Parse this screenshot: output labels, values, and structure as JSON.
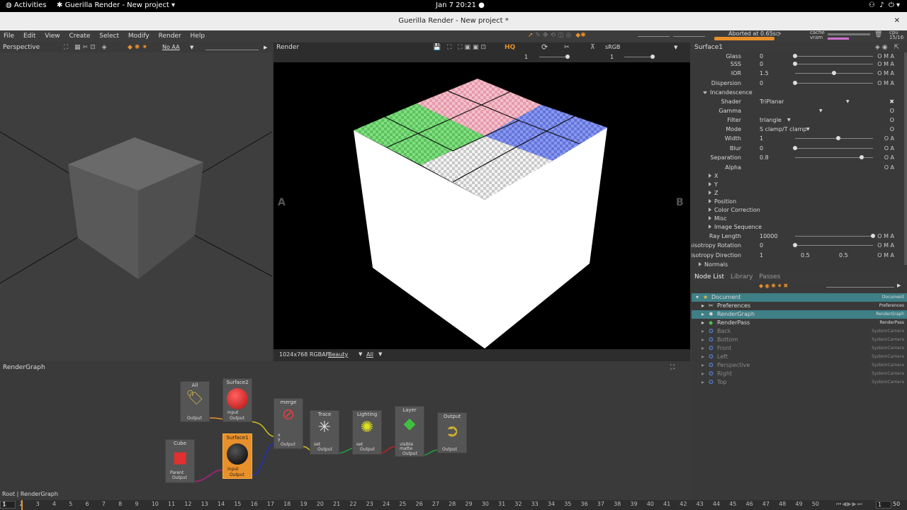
{
  "topbar": {
    "activities": "Activities",
    "app": "Guerilla Render - New project",
    "clock": "Jan 7  20:21"
  },
  "window": {
    "title": "Guerilla Render - New project *"
  },
  "menu": [
    "File",
    "Edit",
    "View",
    "Create",
    "Select",
    "Modify",
    "Render",
    "Help"
  ],
  "status": {
    "aborted": "Aborted at 0.65s",
    "cache": "cache",
    "vram": "vram",
    "cpu": "cpu",
    "cpu_count": "15/16"
  },
  "perspective": {
    "title": "Perspective",
    "aa": "No AA"
  },
  "render": {
    "title": "Render",
    "colorspace": "sRGB",
    "exposure": "1",
    "gamma": "1",
    "label_a": "A",
    "label_b": "B",
    "resolution": "1024x768 RGBAF",
    "aov": "Beauty",
    "filter": "All"
  },
  "props": {
    "title": "Surface1",
    "rows": [
      {
        "label": "Glass",
        "value": "0",
        "slider": 0.0,
        "oma": "O M A"
      },
      {
        "label": "SSS",
        "value": "0",
        "slider": 0.0,
        "oma": "O M A"
      },
      {
        "label": "IOR",
        "value": "1.5",
        "slider": 0.5,
        "oma": "O M A"
      },
      {
        "label": "Dispersion",
        "value": "0",
        "slider": 0.0,
        "oma": "O M A"
      }
    ],
    "incandescence": "Incandescence",
    "shader_label": "Shader",
    "shader_value": "TriPlanar",
    "gamma_label": "Gamma",
    "filter_label": "Filter",
    "filter_value": "triangle",
    "mode_label": "Mode",
    "mode_value": "S clamp/T clamp",
    "rows2": [
      {
        "label": "Width",
        "value": "1",
        "slider": 0.55,
        "oma": "O A"
      },
      {
        "label": "Blur",
        "value": "0",
        "slider": 0.0,
        "oma": "O A"
      },
      {
        "label": "Separation",
        "value": "0.8",
        "slider": 0.85,
        "oma": "O A"
      }
    ],
    "alpha_label": "Alpha",
    "collapsed": [
      "X",
      "Y",
      "Z",
      "Position",
      "Color Correction",
      "Misc",
      "Image Sequence"
    ],
    "ray_length_label": "Ray Length",
    "ray_length_value": "10000",
    "aniso_rot_label": "Anisotropy Rotation",
    "aniso_rot_value": "0",
    "aniso_dir_label": "Anisotropy Direction",
    "aniso_dir_values": [
      "1",
      "0.5",
      "0.5"
    ],
    "normals": "Normals"
  },
  "nodelist": {
    "tabs": [
      "Node List",
      "Library",
      "Passes"
    ],
    "rows": [
      {
        "name": "Document",
        "type": "Document",
        "indent": 0,
        "color": "#f0c040"
      },
      {
        "name": "Preferences",
        "type": "Preferences",
        "indent": 1,
        "color": "#dddddd"
      },
      {
        "name": "RenderGraph",
        "type": "RenderGraph",
        "indent": 1,
        "color": "#dddddd"
      },
      {
        "name": "RenderPass",
        "type": "RenderPass",
        "indent": 1,
        "color": "#50c050"
      },
      {
        "name": "Back",
        "type": "SystemCamera",
        "indent": 1,
        "color": "#5080d0"
      },
      {
        "name": "Bottom",
        "type": "SystemCamera",
        "indent": 1,
        "color": "#5080d0"
      },
      {
        "name": "Front",
        "type": "SystemCamera",
        "indent": 1,
        "color": "#5080d0"
      },
      {
        "name": "Left",
        "type": "SystemCamera",
        "indent": 1,
        "color": "#5080d0"
      },
      {
        "name": "Perspective",
        "type": "SystemCamera",
        "indent": 1,
        "color": "#5080d0"
      },
      {
        "name": "Right",
        "type": "SystemCamera",
        "indent": 1,
        "color": "#5080d0"
      },
      {
        "name": "Top",
        "type": "SystemCamera",
        "indent": 1,
        "color": "#5080d0"
      }
    ]
  },
  "graph": {
    "title": "RenderGraph",
    "path": "Root | RenderGraph",
    "nodes": {
      "all": {
        "title": "All",
        "out": "Output"
      },
      "surface2": {
        "title": "Surface2",
        "in": "Input",
        "out": "Output"
      },
      "merge": {
        "title": "merge",
        "in1": "x",
        "in2": "y",
        "out": "Output"
      },
      "trace": {
        "title": "Trace",
        "in": "set",
        "out": "Output"
      },
      "lighting": {
        "title": "Lighting",
        "in": "set",
        "out": "Output"
      },
      "layer": {
        "title": "Layer",
        "in1": "visible",
        "in2": "matte",
        "out": "Output"
      },
      "output": {
        "title": "Output",
        "out": "Output"
      },
      "cube": {
        "title": "Cube",
        "in": "Parent",
        "out": "Output"
      },
      "surface1": {
        "title": "Surface1",
        "in": "Input",
        "out": "Output"
      }
    }
  },
  "timeline": {
    "frame": "1",
    "end": "50",
    "ticks": [
      "1",
      "2",
      "3",
      "4",
      "5",
      "6",
      "7",
      "8",
      "9",
      "10",
      "11",
      "12",
      "13",
      "14",
      "15",
      "16",
      "17",
      "18",
      "19",
      "20",
      "21",
      "22",
      "23",
      "24",
      "25",
      "26",
      "27",
      "28",
      "29",
      "30",
      "31",
      "32",
      "33",
      "34",
      "35",
      "36",
      "37",
      "38",
      "39",
      "40",
      "41",
      "42",
      "43",
      "44",
      "45",
      "46",
      "47",
      "48",
      "49",
      "50"
    ]
  },
  "colors": {
    "accent": "#e8902a",
    "selection": "#3f7f86",
    "checker_green": "#7ee07e",
    "checker_pink": "#f0b0c0",
    "checker_blue": "#7f8ff0"
  }
}
